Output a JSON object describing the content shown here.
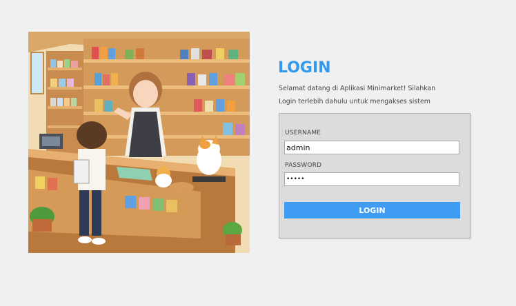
{
  "title": "LOGIN",
  "welcome": {
    "line1": "Selamat datang di Aplikasi Minimarket! Silahkan",
    "line2": "Login terlebih dahulu untuk mengakses sistem"
  },
  "form": {
    "username_label": "USERNAME",
    "username_value": "admin",
    "password_label": "PASSWORD",
    "password_value": "admin",
    "submit_label": "LOGIN"
  },
  "illustration": {
    "icon": "minimarket-illustration"
  },
  "colors": {
    "accent": "#3399ee",
    "button": "#3f9cf2",
    "page_background": "#f0f0f0",
    "panel_background": "#dcdcdc"
  }
}
